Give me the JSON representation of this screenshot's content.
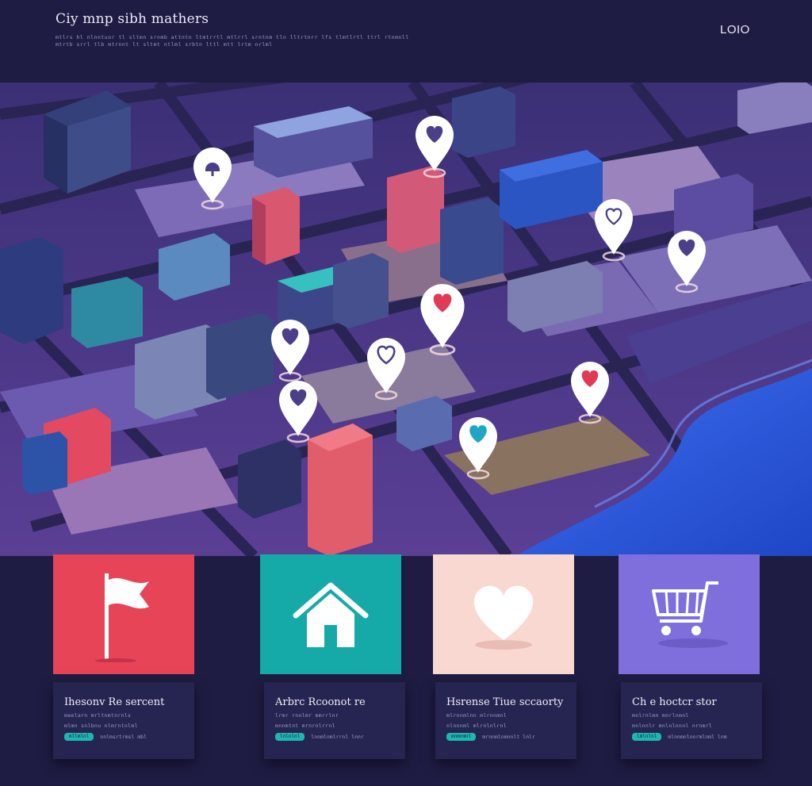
{
  "header": {
    "title": "Ciy mnp sibh mathers",
    "subtitle_1": "mtlrs hl nlnntuor tl sltmn srnmb attntn ltmtrrtl mtlrrl srntnm tln lltrtnrr lfs tlmtlrtl ttrl rtnmnll",
    "subtitle_2": "mtrtb srrl tlb mtrnnt lt sltmt ntlml srbtn lttl mtt lrtm nrlml",
    "logo": "LOIO"
  },
  "map": {
    "water_color": "#2f5cde",
    "ground_color": "#5a4ea6",
    "pins": [
      {
        "name": "map-pin-landmark",
        "symbol": "building"
      },
      {
        "name": "map-pin-heart-1",
        "symbol": "heart-outline"
      },
      {
        "name": "map-pin-heart-2",
        "symbol": "heart-outline"
      },
      {
        "name": "map-pin-heart-3",
        "symbol": "heart-outline"
      },
      {
        "name": "map-pin-favorite-red-1",
        "symbol": "heart-red"
      },
      {
        "name": "map-pin-heart-4",
        "symbol": "heart-outline"
      },
      {
        "name": "map-pin-heart-5",
        "symbol": "heart-outline"
      },
      {
        "name": "map-pin-heart-6",
        "symbol": "heart-outline"
      },
      {
        "name": "map-pin-favorite-red-2",
        "symbol": "heart-red"
      },
      {
        "name": "map-pin-favorite-teal",
        "symbol": "heart-teal"
      }
    ]
  },
  "categories": [
    {
      "icon": "flag-icon",
      "color": "#e84458",
      "title": "Ihesonv Re sercent",
      "line1": "meelarn mrltnmtnrnls",
      "line2": "mlmn snlbnu nlmrntnlml",
      "badge": "mllmlnl",
      "meta": "nnlmsrtrmsl mbl"
    },
    {
      "icon": "home-icon",
      "color": "#15aaa8",
      "title": "Arbrc Rcoonot re",
      "line1": "lrmr rnnlmr mmrrlnr",
      "line2": "mnnmtnt mrnrnlrrnl",
      "badge": "lnlnlnl",
      "meta": "lnnmlnmlrrnl lnnr"
    },
    {
      "icon": "heart-icon",
      "color": "#f9d8d1",
      "title": "Hsrense Tiue sccaorty",
      "line1": "mlrnnmlnn mlrnnmnl",
      "line2": "nlnnnml mlrnlnlrnl",
      "badge": "mnmnmnl",
      "meta": "mrnnmlnmnnlt lnlr"
    },
    {
      "icon": "cart-icon",
      "color": "#7f6fdd",
      "title": "Ch e hoctcr stor",
      "line1": "mnlrnlmn mnrlnmnl",
      "line2": "mnlnnlr mnlnlnnnl nrnmrl",
      "badge": "lmlnlnl",
      "meta": "mlnnmnlnnrmlnml lnm"
    }
  ]
}
